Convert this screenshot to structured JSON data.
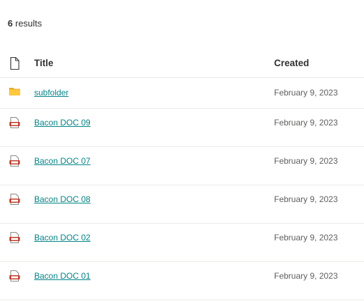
{
  "results": {
    "count": "6",
    "label": "results"
  },
  "columns": {
    "title": "Title",
    "created": "Created"
  },
  "rows": [
    {
      "icon": "folder-icon",
      "title": "subfolder",
      "created": "February 9, 2023"
    },
    {
      "icon": "pdf-file-icon",
      "title": "Bacon DOC 09",
      "created": "February 9, 2023"
    },
    {
      "icon": "pdf-file-icon",
      "title": "Bacon DOC 07",
      "created": "February 9, 2023"
    },
    {
      "icon": "pdf-file-icon",
      "title": "Bacon DOC 08",
      "created": "February 9, 2023"
    },
    {
      "icon": "pdf-file-icon",
      "title": "Bacon DOC 02",
      "created": "February 9, 2023"
    },
    {
      "icon": "pdf-file-icon",
      "title": "Bacon DOC 01",
      "created": "February 9, 2023"
    }
  ],
  "colors": {
    "link": "#038387",
    "folder": "#FFC83D",
    "pdf": "#C03B2B"
  }
}
